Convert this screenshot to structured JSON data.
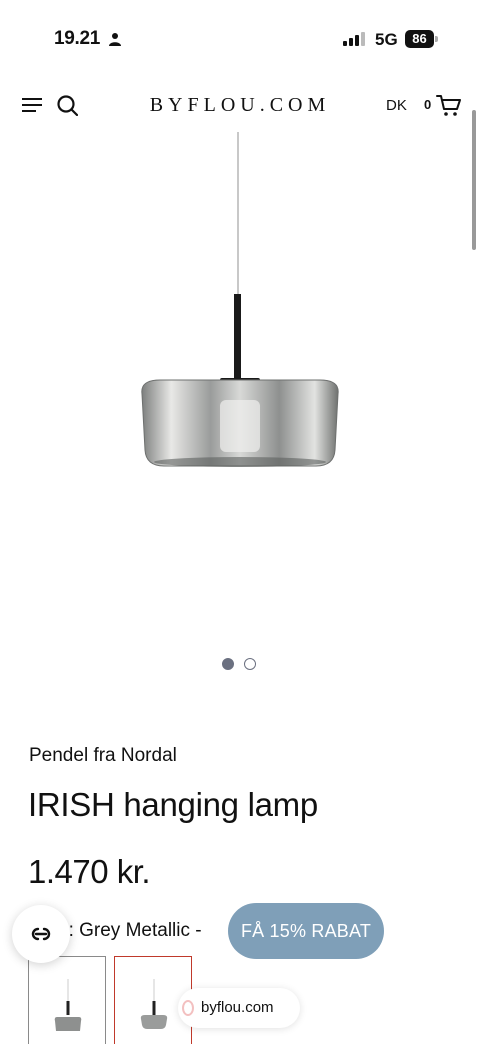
{
  "status_bar": {
    "time": "19.21",
    "network": "5G",
    "battery": "86"
  },
  "header": {
    "logo": "BYFLOU.COM",
    "language": "DK",
    "cart_count": "0"
  },
  "product": {
    "brand_line": "Pendel fra Nordal",
    "title": "IRISH hanging lamp",
    "price": "1.470 kr.",
    "variant_label_visible": "e: Grey Metallic -"
  },
  "carousel": {
    "total_images": 2,
    "active_index": 0
  },
  "discount_button": {
    "label": "FÅ 15% RABAT",
    "color": "#7f9fb8"
  },
  "browser": {
    "url": "byflou.com"
  },
  "icons": [
    "person-icon",
    "signal-icon",
    "menu-icon",
    "search-icon",
    "cart-icon",
    "chat-icon"
  ],
  "colors": {
    "selected_swatch_border": "#c0392b",
    "dot": "#6b7080"
  }
}
